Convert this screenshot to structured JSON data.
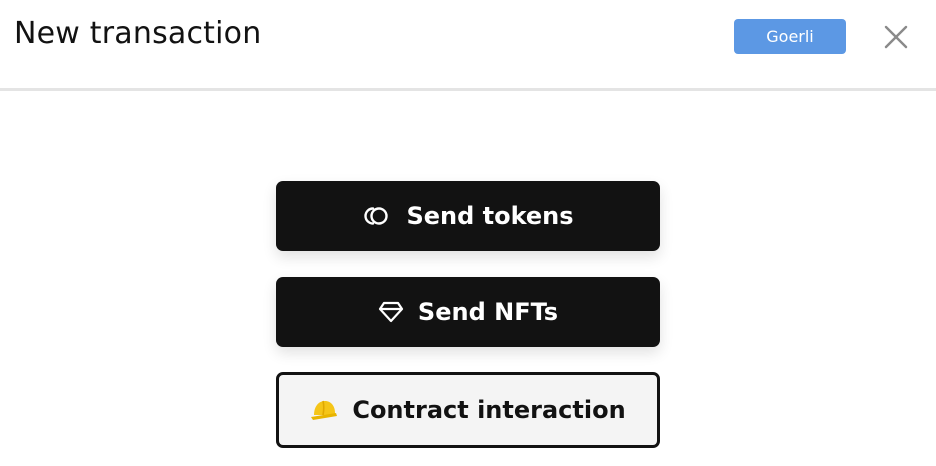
{
  "dialog": {
    "title": "New transaction",
    "network_chip": "Goerli",
    "close_icon": "close-icon"
  },
  "actions": {
    "send_tokens": {
      "label": "Send tokens",
      "icon": "coins-icon"
    },
    "send_nfts": {
      "label": "Send NFTs",
      "icon": "diamond-icon"
    },
    "contract_interaction": {
      "label": "Contract interaction",
      "icon": "hard-hat-icon"
    }
  },
  "colors": {
    "chip": "#5c98e4",
    "dark_button": "#121212",
    "light_button": "#f4f4f4",
    "hard_hat": "#f5c518"
  }
}
